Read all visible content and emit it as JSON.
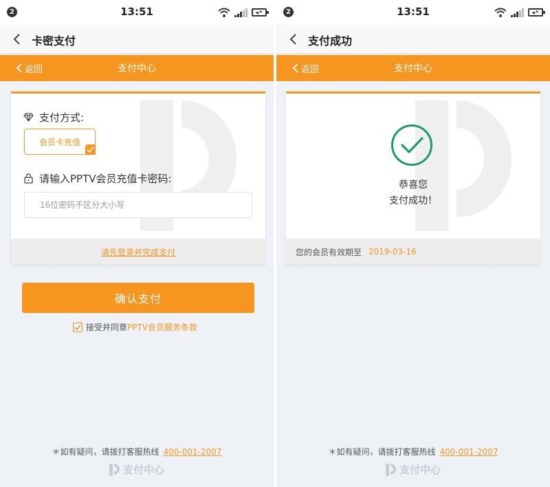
{
  "colors": {
    "accent": "#f7961e",
    "success": "#1a9b6c",
    "background": "#eef1f6"
  },
  "statusbar": {
    "badge": "2",
    "time": "13:51"
  },
  "left": {
    "title": "卡密支付",
    "nav": {
      "back_label": "返回",
      "title": "支付中心"
    },
    "card": {
      "method_label": "支付方式:",
      "method_option": "会员卡充值",
      "password_label": "请输入PPTV会员充值卡密码:",
      "password_placeholder": "16位密码不区分大小写",
      "login_link": "请先登录并完成支付"
    },
    "confirm_label": "确认支付",
    "agree": {
      "prefix": "接受并同意",
      "link": "PPTV会员服务条款"
    },
    "hotline": {
      "label": "＊如有疑问，请拨打客服热线",
      "number": "400-001-2007"
    },
    "brand": "支付中心"
  },
  "right": {
    "title": "支付成功",
    "nav": {
      "back_label": "返回",
      "title": "支付中心"
    },
    "card": {
      "line1": "恭喜您",
      "line2": "支付成功！",
      "expire_label": "您的会员有效期至",
      "expire_date": "2019-03-16"
    },
    "hotline": {
      "label": "＊如有疑问，请拨打客服热线",
      "number": "400-001-2007"
    },
    "brand": "支付中心"
  }
}
